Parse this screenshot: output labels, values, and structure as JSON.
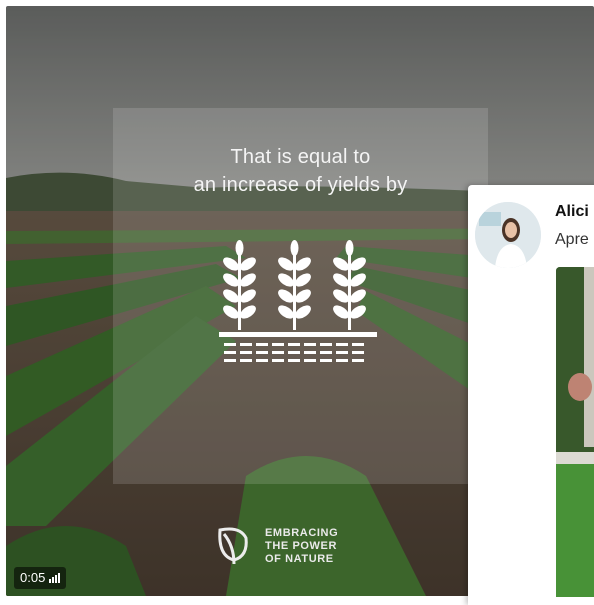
{
  "video": {
    "caption_line1": "That is equal to",
    "caption_line2": "an increase of yields by",
    "icon": "crop-field-icon",
    "brand": {
      "logo": "leaf-logo",
      "line1": "EMBRACING",
      "line2": "THE POWER",
      "line3": "OF NATURE"
    },
    "time": "0:05",
    "sound_icon": "volume-bars-icon"
  },
  "popup": {
    "author_name": "Alici",
    "author_subtitle": "Apre",
    "avatar_icon": "profile-avatar"
  },
  "colors": {
    "sky": "#8d8f8c",
    "field_green": "#3e6d2f",
    "soil": "#5a4a3c",
    "overlay": "#ffffff"
  }
}
